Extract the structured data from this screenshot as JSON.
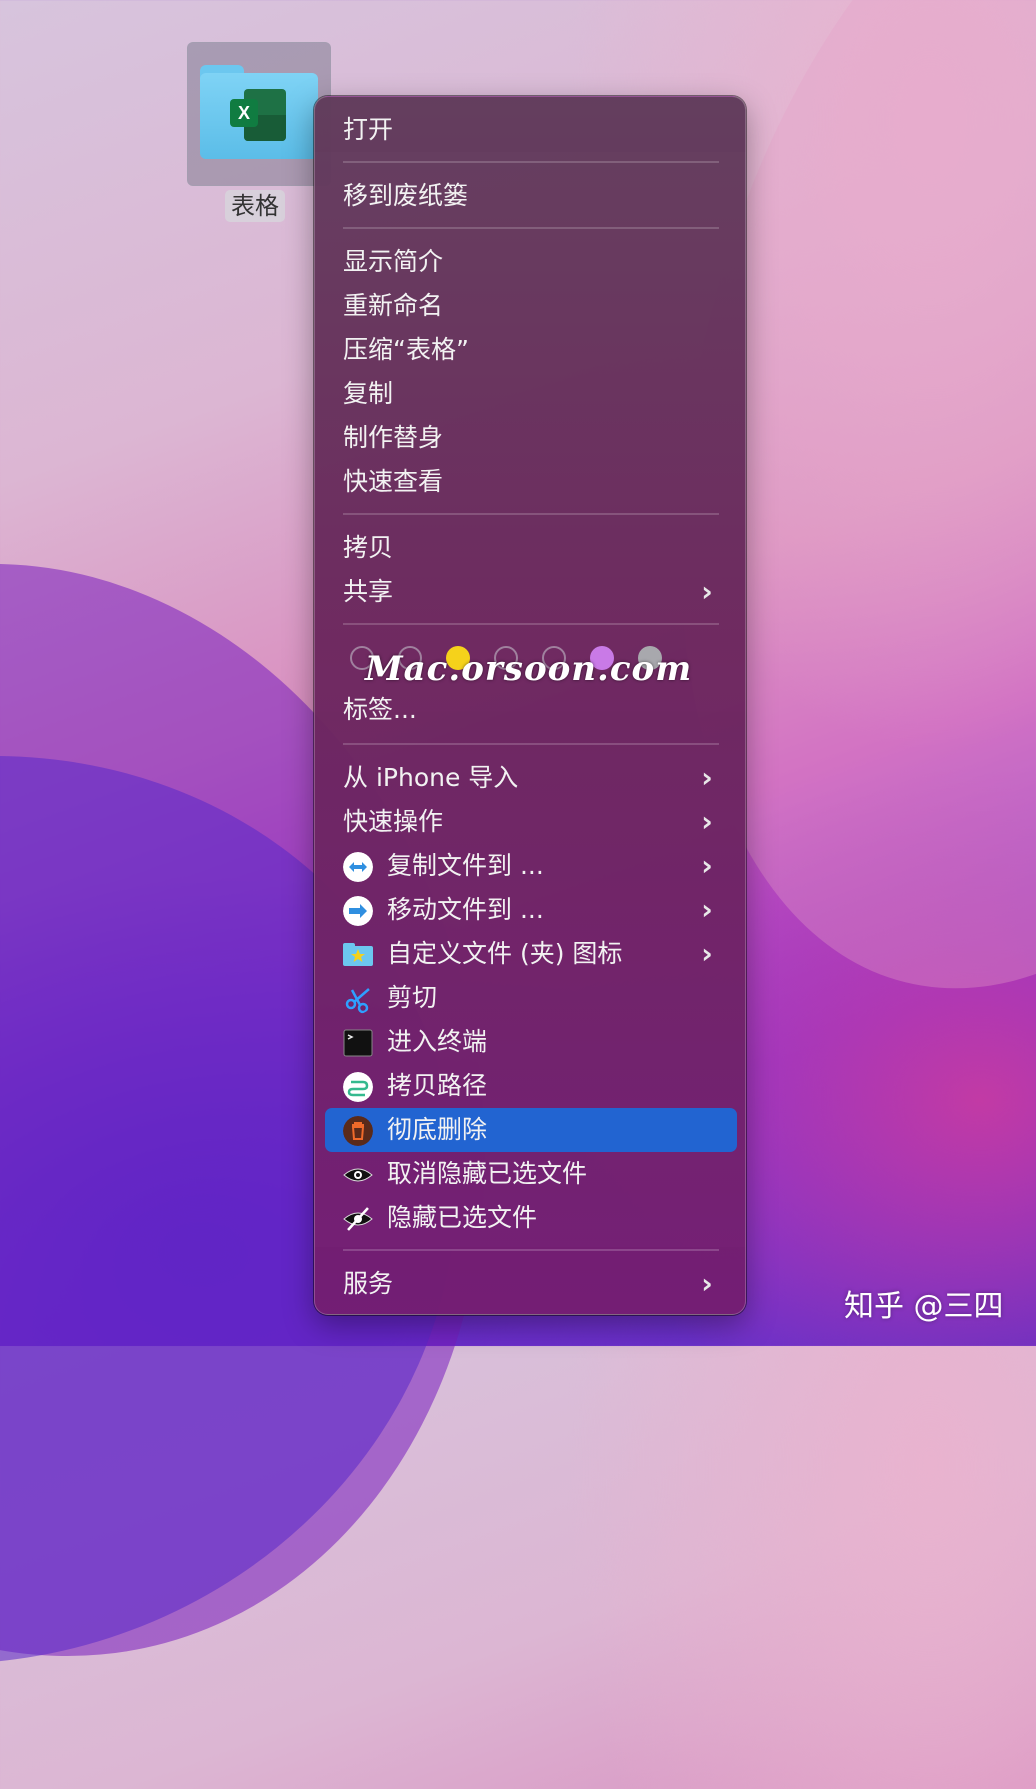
{
  "desktop": {
    "icon_label": "表格",
    "excel_letter": "X",
    "footer_watermark": "知乎 @三四"
  },
  "menu": {
    "open": "打开",
    "trash": "移到废纸篓",
    "get_info": "显示简介",
    "rename": "重新命名",
    "compress": "压缩“表格”",
    "duplicate": "复制",
    "make_alias": "制作替身",
    "quick_look": "快速查看",
    "copy": "拷贝",
    "share": "共享",
    "tags_label": "标签...",
    "tag_colors": [
      "empty",
      "empty",
      "#f5d21b",
      "empty",
      "empty",
      "#c97ae7",
      "#a8a8ad"
    ],
    "watermark": "Mac.orsoon.com",
    "import_iphone": "从 iPhone 导入",
    "quick_actions": "快速操作",
    "copy_to": "复制文件到 ...",
    "move_to": "移动文件到 ...",
    "custom_icon": "自定义文件 (夹) 图标",
    "cut": "剪切",
    "terminal": "进入终端",
    "copy_path": "拷贝路径",
    "delete_permanently": "彻底删除",
    "unhide": "取消隐藏已选文件",
    "hide": "隐藏已选文件",
    "services": "服务",
    "chevron": "›",
    "highlighted_item": "delete_permanently",
    "highlight_color": "#2264d1"
  }
}
